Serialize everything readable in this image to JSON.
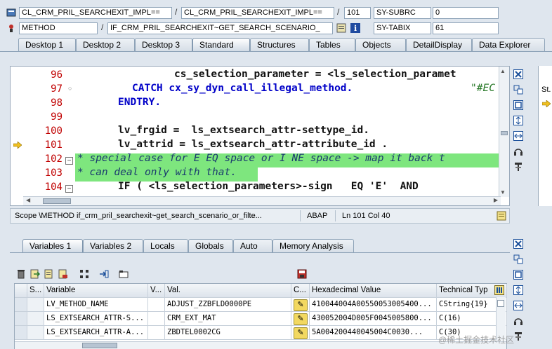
{
  "header": {
    "row1": {
      "program": "CL_CRM_PRIL_SEARCHEXIT_IMPL==",
      "include": "CL_CRM_PRIL_SEARCHEXIT_IMPL==",
      "line": "101",
      "sysvar_name": "SY-SUBRC",
      "sysvar_value": "0"
    },
    "row2": {
      "type": "METHOD",
      "name": "IF_CRM_PRIL_SEARCHEXIT~GET_SEARCH_SCENARIO_",
      "sysvar_name": "SY-TABIX",
      "sysvar_value": "61"
    }
  },
  "desktop_tabs": [
    "Desktop 1",
    "Desktop 2",
    "Desktop 3",
    "Standard",
    "Structures",
    "Tables",
    "Objects",
    "DetailDisplay",
    "Data Explorer"
  ],
  "editor": {
    "lines": [
      {
        "num": "96",
        "code": "cs_selection_parameter = <ls_selection_paramet"
      },
      {
        "num": "97",
        "code": "CATCH cx_sy_dyn_call_illegal_method.",
        "comment": "\"#EC"
      },
      {
        "num": "98",
        "code": "ENDTRY."
      },
      {
        "num": "99",
        "code": ""
      },
      {
        "num": "100",
        "code": "lv_frgid =  ls_extsearch_attr-settype_id."
      },
      {
        "num": "101",
        "code": "lv_attrid = ls_extsearch_attr-attribute_id ."
      },
      {
        "num": "102",
        "code": "* special case for E EQ space or I NE space -> map it back t"
      },
      {
        "num": "103",
        "code": "* can deal only with that."
      },
      {
        "num": "104",
        "code": "IF ( <ls_selection_parameters>-sign   EQ 'E'  AND"
      }
    ]
  },
  "status": {
    "scope": "Scope \\METHOD if_crm_pril_searchexit~get_search_scenario_or_filte...",
    "language": "ABAP",
    "position": "Ln 101 Col  40"
  },
  "right_panel": {
    "label": "St."
  },
  "variable_tabs": [
    "Variables 1",
    "Variables 2",
    "Locals",
    "Globals",
    "Auto",
    "Memory Analysis"
  ],
  "variables": {
    "columns": [
      "S...",
      "Variable",
      "V...",
      "Val.",
      "C...",
      "Hexadecimal Value",
      "Technical Typ"
    ],
    "rows": [
      {
        "name": "LV_METHOD_NAME",
        "value": "ADJUST_ZZBFLD0000PE",
        "hex": "410044004A00550053005400...",
        "type": "CString{19}"
      },
      {
        "name": "LS_EXTSEARCH_ATTR-S...",
        "value": "CRM_EXT_MAT",
        "hex": "430052004D005F0045005800...",
        "type": "C(16)"
      },
      {
        "name": "LS_EXTSEARCH_ATTR-A...",
        "value": "ZBDTEL0002CG",
        "hex": "5A004200440045004C0030...",
        "type": "C(30)"
      }
    ]
  },
  "watermark": "@稀土掘金技术社区"
}
